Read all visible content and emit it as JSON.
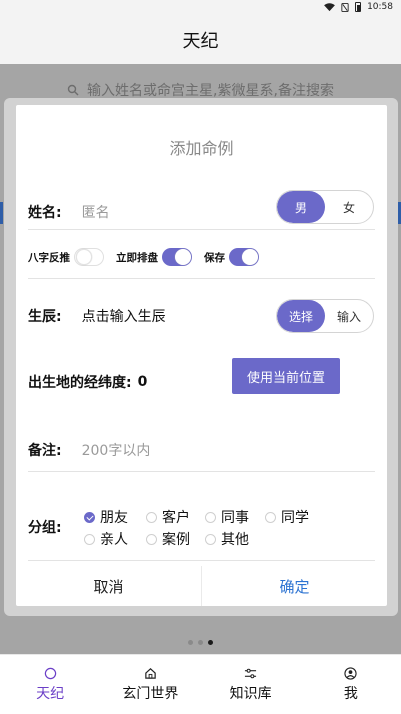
{
  "status": {
    "time": "10:58"
  },
  "appbar": {
    "title": "天纪"
  },
  "background": {
    "search_placeholder": "输入姓名或命宫主星,紫微星系,备注搜索"
  },
  "dialog": {
    "title": "添加命例",
    "name": {
      "label": "姓名:",
      "placeholder": "匿名",
      "gender_options": [
        "男",
        "女"
      ],
      "gender_selected": "男"
    },
    "toggles": [
      {
        "label": "八字反推",
        "on": false
      },
      {
        "label": "立即排盘",
        "on": true
      },
      {
        "label": "保存",
        "on": true
      }
    ],
    "birth": {
      "label": "生辰:",
      "placeholder": "点击输入生辰",
      "mode_options": [
        "选择",
        "输入"
      ],
      "mode_selected": "选择"
    },
    "location": {
      "label": "出生地的经纬度:",
      "value": "0",
      "button": "使用当前位置"
    },
    "note": {
      "label": "备注:",
      "placeholder": "200字以内"
    },
    "group": {
      "label": "分组:",
      "options": [
        "朋友",
        "客户",
        "同事",
        "同学",
        "亲人",
        "案例",
        "其他"
      ],
      "selected": "朋友"
    },
    "cancel_label": "取消",
    "confirm_label": "确定"
  },
  "nav": {
    "items": [
      {
        "label": "天纪",
        "icon": "circle-icon",
        "active": true
      },
      {
        "label": "玄门世界",
        "icon": "home-icon",
        "active": false
      },
      {
        "label": "知识库",
        "icon": "sliders-icon",
        "active": false
      },
      {
        "label": "我",
        "icon": "user-icon",
        "active": false
      }
    ]
  },
  "colors": {
    "accent": "#6b69c9",
    "confirm": "#2c73d2",
    "nav_active": "#6b3fc7"
  }
}
